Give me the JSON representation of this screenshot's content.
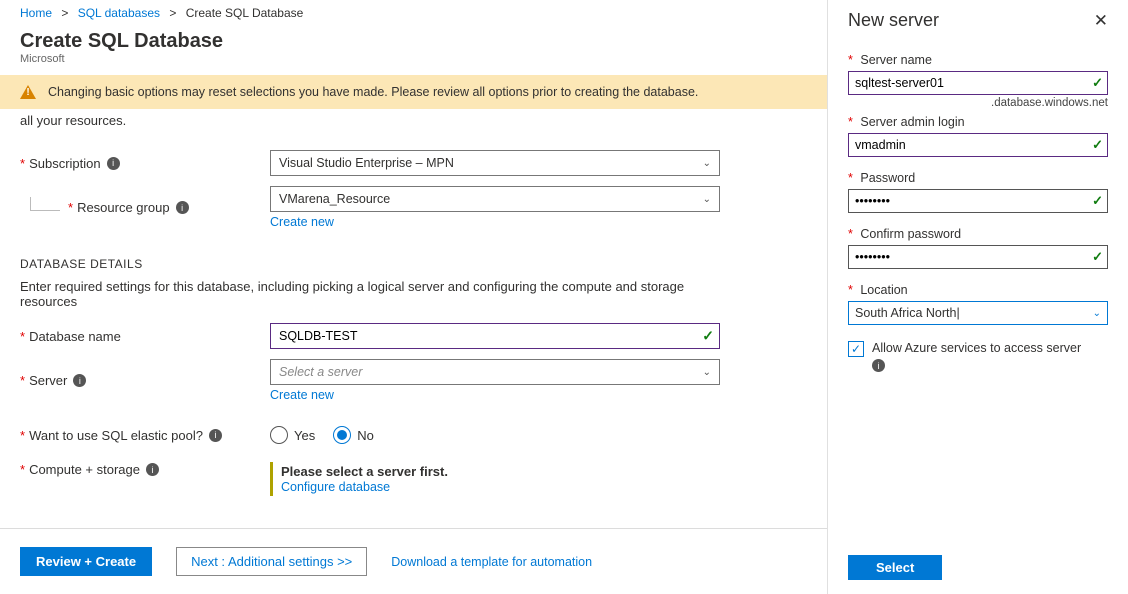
{
  "breadcrumbs": {
    "home": "Home",
    "sql_databases": "SQL databases",
    "current": "Create SQL Database"
  },
  "page": {
    "title": "Create SQL Database",
    "subtitle": "Microsoft"
  },
  "warning": "Changing basic options may reset selections you have made. Please review all options prior to creating the database.",
  "truncated_top": "all your resources.",
  "labels": {
    "subscription": "Subscription",
    "resource_group": "Resource group",
    "database_name": "Database name",
    "server": "Server",
    "elastic_pool": "Want to use SQL elastic pool?",
    "compute_storage": "Compute + storage"
  },
  "values": {
    "subscription": "Visual Studio Enterprise – MPN",
    "resource_group": "VMarena_Resource",
    "database_name": "SQLDB-TEST",
    "server_placeholder": "Select a server",
    "create_new": "Create new",
    "yes": "Yes",
    "no": "No",
    "elastic_selected": "no"
  },
  "sections": {
    "database_details_header": "DATABASE DETAILS",
    "database_details_desc": "Enter required settings for this database, including picking a logical server and configuring the compute and storage resources"
  },
  "compute_msg": {
    "line1": "Please select a server first.",
    "configure": "Configure database"
  },
  "footer": {
    "review": "Review + Create",
    "next": "Next : Additional settings  >>",
    "download": "Download a template for automation"
  },
  "blade": {
    "title": "New server",
    "server_name_label": "Server name",
    "server_name_value": "sqltest-server01",
    "server_name_suffix": ".database.windows.net",
    "admin_login_label": "Server admin login",
    "admin_login_value": "vmadmin",
    "password_label": "Password",
    "password_value": "••••••••",
    "confirm_password_label": "Confirm password",
    "confirm_password_value": "••••••••",
    "location_label": "Location",
    "location_value": "South Africa North",
    "allow_azure": "Allow Azure services to access server",
    "select_button": "Select"
  }
}
